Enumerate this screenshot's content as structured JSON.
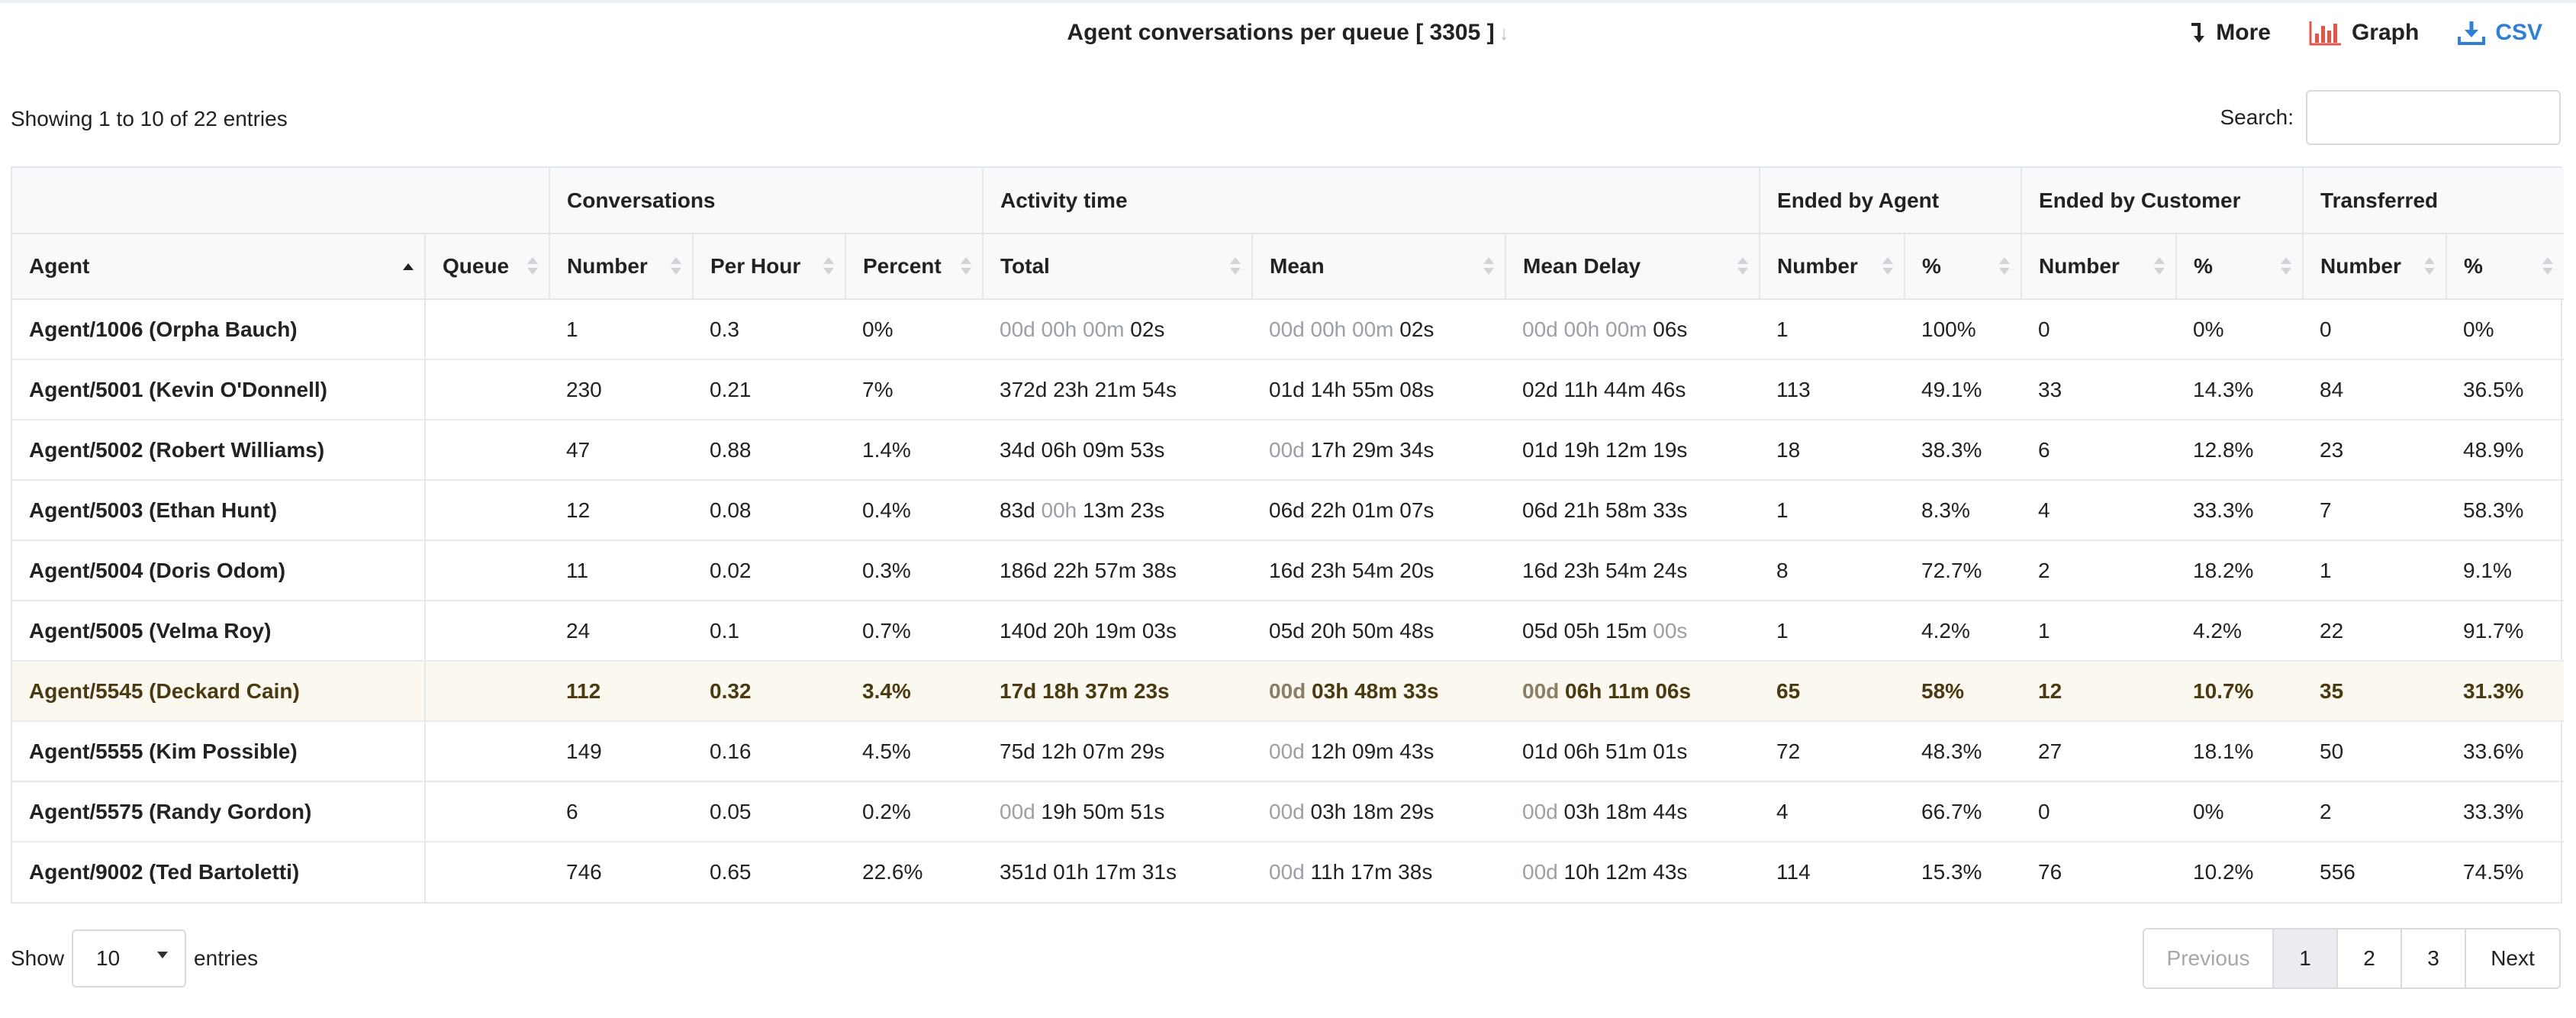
{
  "header": {
    "title": "Agent conversations per queue [ 3305 ]",
    "sort_icon": "arrow-down-icon",
    "actions": [
      {
        "label": "More",
        "icon": "turn-down-arrow-icon"
      },
      {
        "label": "Graph",
        "icon": "bar-chart-icon",
        "color": "#e0574a"
      },
      {
        "label": "CSV",
        "icon": "download-icon",
        "color": "#2f7fd6"
      }
    ]
  },
  "info": "Showing 1 to 10 of 22 entries",
  "search": {
    "label": "Search:",
    "value": ""
  },
  "table": {
    "group_headers": [
      "Conversations",
      "Activity time",
      "Ended by Agent",
      "Ended by Customer",
      "Transferred"
    ],
    "columns": [
      "Agent",
      "Queue",
      "Number",
      "Per Hour",
      "Percent",
      "Total",
      "Mean",
      "Mean Delay",
      "Number",
      "%",
      "Number",
      "%",
      "Number",
      "%"
    ],
    "sorted_column": "Agent",
    "sort_direction": "ascending",
    "highlight_row_index": 6,
    "rows": [
      {
        "agent": "Agent/1006 (Orpha Bauch)",
        "queue": "",
        "number": "1",
        "per_hour": "0.3",
        "percent": "0%",
        "total": {
          "dim": "00d 00h 00m",
          "val": "02s"
        },
        "mean": {
          "dim": "00d 00h 00m",
          "val": "02s"
        },
        "delay": {
          "dim": "00d 00h 00m",
          "val": "06s"
        },
        "ea_n": "1",
        "ea_p": "100%",
        "ec_n": "0",
        "ec_p": "0%",
        "tr_n": "0",
        "tr_p": "0%"
      },
      {
        "agent": "Agent/5001 (Kevin O'Donnell)",
        "queue": "",
        "number": "230",
        "per_hour": "0.21",
        "percent": "7%",
        "total": {
          "dim": "",
          "val": "372d 23h 21m 54s"
        },
        "mean": {
          "dim": "",
          "val": "01d 14h 55m 08s"
        },
        "delay": {
          "dim": "",
          "val": "02d 11h 44m 46s"
        },
        "ea_n": "113",
        "ea_p": "49.1%",
        "ec_n": "33",
        "ec_p": "14.3%",
        "tr_n": "84",
        "tr_p": "36.5%"
      },
      {
        "agent": "Agent/5002 (Robert Williams)",
        "queue": "",
        "number": "47",
        "per_hour": "0.88",
        "percent": "1.4%",
        "total": {
          "dim": "",
          "val": "34d 06h 09m 53s"
        },
        "mean": {
          "dim": "00d",
          "val": "17h 29m 34s"
        },
        "delay": {
          "dim": "",
          "val": "01d 19h 12m 19s"
        },
        "ea_n": "18",
        "ea_p": "38.3%",
        "ec_n": "6",
        "ec_p": "12.8%",
        "tr_n": "23",
        "tr_p": "48.9%"
      },
      {
        "agent": "Agent/5003 (Ethan Hunt)",
        "queue": "",
        "number": "12",
        "per_hour": "0.08",
        "percent": "0.4%",
        "total": {
          "pre": "83d",
          "dim": "00h",
          "val": "13m 23s"
        },
        "mean": {
          "dim": "",
          "val": "06d 22h 01m 07s"
        },
        "delay": {
          "dim": "",
          "val": "06d 21h 58m 33s"
        },
        "ea_n": "1",
        "ea_p": "8.3%",
        "ec_n": "4",
        "ec_p": "33.3%",
        "tr_n": "7",
        "tr_p": "58.3%"
      },
      {
        "agent": "Agent/5004 (Doris Odom)",
        "queue": "",
        "number": "11",
        "per_hour": "0.02",
        "percent": "0.3%",
        "total": {
          "dim": "",
          "val": "186d 22h 57m 38s"
        },
        "mean": {
          "dim": "",
          "val": "16d 23h 54m 20s"
        },
        "delay": {
          "dim": "",
          "val": "16d 23h 54m 24s"
        },
        "ea_n": "8",
        "ea_p": "72.7%",
        "ec_n": "2",
        "ec_p": "18.2%",
        "tr_n": "1",
        "tr_p": "9.1%"
      },
      {
        "agent": "Agent/5005 (Velma Roy)",
        "queue": "",
        "number": "24",
        "per_hour": "0.1",
        "percent": "0.7%",
        "total": {
          "dim": "",
          "val": "140d 20h 19m 03s"
        },
        "mean": {
          "dim": "",
          "val": "05d 20h 50m 48s"
        },
        "delay": {
          "pre": "05d 05h 15m",
          "dim": "00s",
          "val": ""
        },
        "ea_n": "1",
        "ea_p": "4.2%",
        "ec_n": "1",
        "ec_p": "4.2%",
        "tr_n": "22",
        "tr_p": "91.7%"
      },
      {
        "agent": "Agent/5545 (Deckard Cain)",
        "queue": "",
        "number": "112",
        "per_hour": "0.32",
        "percent": "3.4%",
        "total": {
          "dim": "",
          "val": "17d 18h 37m 23s"
        },
        "mean": {
          "dim": "00d",
          "val": "03h 48m 33s"
        },
        "delay": {
          "dim": "00d",
          "val": "06h 11m 06s"
        },
        "ea_n": "65",
        "ea_p": "58%",
        "ec_n": "12",
        "ec_p": "10.7%",
        "tr_n": "35",
        "tr_p": "31.3%"
      },
      {
        "agent": "Agent/5555 (Kim Possible)",
        "queue": "",
        "number": "149",
        "per_hour": "0.16",
        "percent": "4.5%",
        "total": {
          "dim": "",
          "val": "75d 12h 07m 29s"
        },
        "mean": {
          "dim": "00d",
          "val": "12h 09m 43s"
        },
        "delay": {
          "dim": "",
          "val": "01d 06h 51m 01s"
        },
        "ea_n": "72",
        "ea_p": "48.3%",
        "ec_n": "27",
        "ec_p": "18.1%",
        "tr_n": "50",
        "tr_p": "33.6%"
      },
      {
        "agent": "Agent/5575 (Randy Gordon)",
        "queue": "",
        "number": "6",
        "per_hour": "0.05",
        "percent": "0.2%",
        "total": {
          "dim": "00d",
          "val": "19h 50m 51s"
        },
        "mean": {
          "dim": "00d",
          "val": "03h 18m 29s"
        },
        "delay": {
          "dim": "00d",
          "val": "03h 18m 44s"
        },
        "ea_n": "4",
        "ea_p": "66.7%",
        "ec_n": "0",
        "ec_p": "0%",
        "tr_n": "2",
        "tr_p": "33.3%"
      },
      {
        "agent": "Agent/9002 (Ted Bartoletti)",
        "queue": "",
        "number": "746",
        "per_hour": "0.65",
        "percent": "22.6%",
        "total": {
          "dim": "",
          "val": "351d 01h 17m 31s"
        },
        "mean": {
          "dim": "00d",
          "val": "11h 17m 38s"
        },
        "delay": {
          "dim": "00d",
          "val": "10h 12m 43s"
        },
        "ea_n": "114",
        "ea_p": "15.3%",
        "ec_n": "76",
        "ec_p": "10.2%",
        "tr_n": "556",
        "tr_p": "74.5%"
      }
    ]
  },
  "length": {
    "show_label": "Show",
    "value": "10",
    "entries_label": "entries"
  },
  "pagination": {
    "previous": "Previous",
    "pages": [
      "1",
      "2",
      "3"
    ],
    "current": "1",
    "next": "Next"
  }
}
